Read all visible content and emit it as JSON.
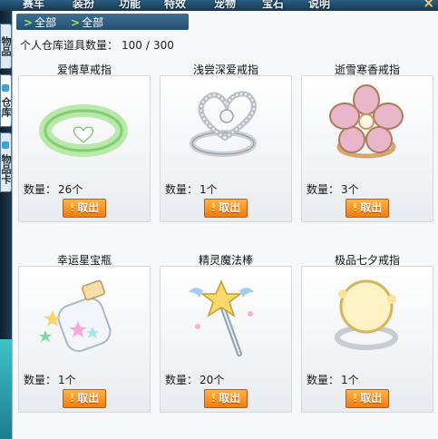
{
  "top_bar": {
    "categories": [
      "赛车",
      "装扮",
      "功能",
      "特效",
      "宠物",
      "宝石",
      "说明"
    ],
    "close_label": "×"
  },
  "left_tabs": {
    "tab_a": "物品",
    "tab_b": "仓库",
    "tab_c": "物品卡"
  },
  "breadcrumb": [
    "全部",
    "全部"
  ],
  "storage": {
    "label": "个人仓库道具数量：",
    "current": "100",
    "separator": "/",
    "max": "300"
  },
  "items": [
    {
      "name": "爱情草戒指",
      "qty_label": "数量：",
      "qty": "26个",
      "button": "取出",
      "icon": "green-heart-ring-icon"
    },
    {
      "name": "浅尝深爱戒指",
      "qty_label": "数量：",
      "qty": "1个",
      "button": "取出",
      "icon": "silver-heart-ring-icon"
    },
    {
      "name": "逝雪寒香戒指",
      "qty_label": "数量：",
      "qty": "3个",
      "button": "取出",
      "icon": "pink-flower-ring-icon"
    },
    {
      "name": "幸运星宝瓶",
      "qty_label": "数量：",
      "qty": "1个",
      "button": "取出",
      "icon": "star-bottle-icon"
    },
    {
      "name": "精灵魔法棒",
      "qty_label": "数量：",
      "qty": "20个",
      "button": "取出",
      "icon": "magic-wand-icon"
    },
    {
      "name": "极品七夕戒指",
      "qty_label": "数量：",
      "qty": "1个",
      "button": "取出",
      "icon": "moon-ring-icon"
    }
  ],
  "colors": {
    "button_orange": "#f07c10",
    "breadcrumb_blue": "#24506f",
    "breadcrumb_arrow": "#9fe36b"
  }
}
